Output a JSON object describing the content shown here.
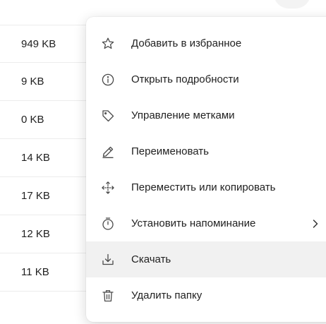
{
  "file_list": {
    "sizes": [
      "949 KB",
      "9 KB",
      "0 KB",
      "14 KB",
      "17 KB",
      "12 KB",
      "11 KB"
    ]
  },
  "context_menu": {
    "items": [
      {
        "label": "Добавить в избранное",
        "icon": "star-icon"
      },
      {
        "label": "Открыть подробности",
        "icon": "info-icon"
      },
      {
        "label": "Управление метками",
        "icon": "tag-icon"
      },
      {
        "label": "Переименовать",
        "icon": "pencil-icon"
      },
      {
        "label": "Переместить или копировать",
        "icon": "move-icon"
      },
      {
        "label": "Установить напоминание",
        "icon": "timer-icon",
        "has_submenu": true
      },
      {
        "label": "Скачать",
        "icon": "download-icon",
        "highlighted": true
      },
      {
        "label": "Удалить папку",
        "icon": "trash-icon"
      }
    ]
  },
  "colors": {
    "menu_hover": "#f1f1f1",
    "icon_stroke": "#4a4a4a"
  }
}
